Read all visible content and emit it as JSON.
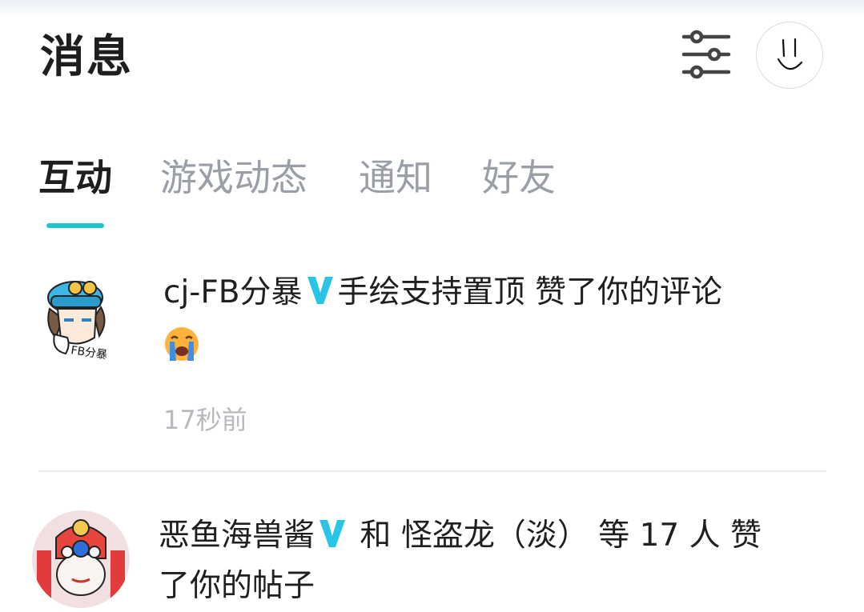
{
  "header": {
    "title": "消息"
  },
  "tabs": [
    {
      "label": "互动",
      "active": true
    },
    {
      "label": "游戏动态",
      "active": false
    },
    {
      "label": "通知",
      "active": false
    },
    {
      "label": "好友",
      "active": false
    }
  ],
  "messages": [
    {
      "user": "cj-FB分暴",
      "verified": true,
      "action": "手绘支持置顶 赞了你的评论",
      "emoji": "crying-face",
      "time": "17秒前",
      "avatar_text": "FB分暴"
    },
    {
      "user": "恶鱼海兽酱",
      "verified": true,
      "action_line1": "和 怪盗龙（淡） 等 17 人 赞",
      "action_line2": "了你的帖子"
    }
  ],
  "colors": {
    "accent": "#1fc6cf",
    "verified": "#29c4e6",
    "muted": "#9a9ea6"
  }
}
